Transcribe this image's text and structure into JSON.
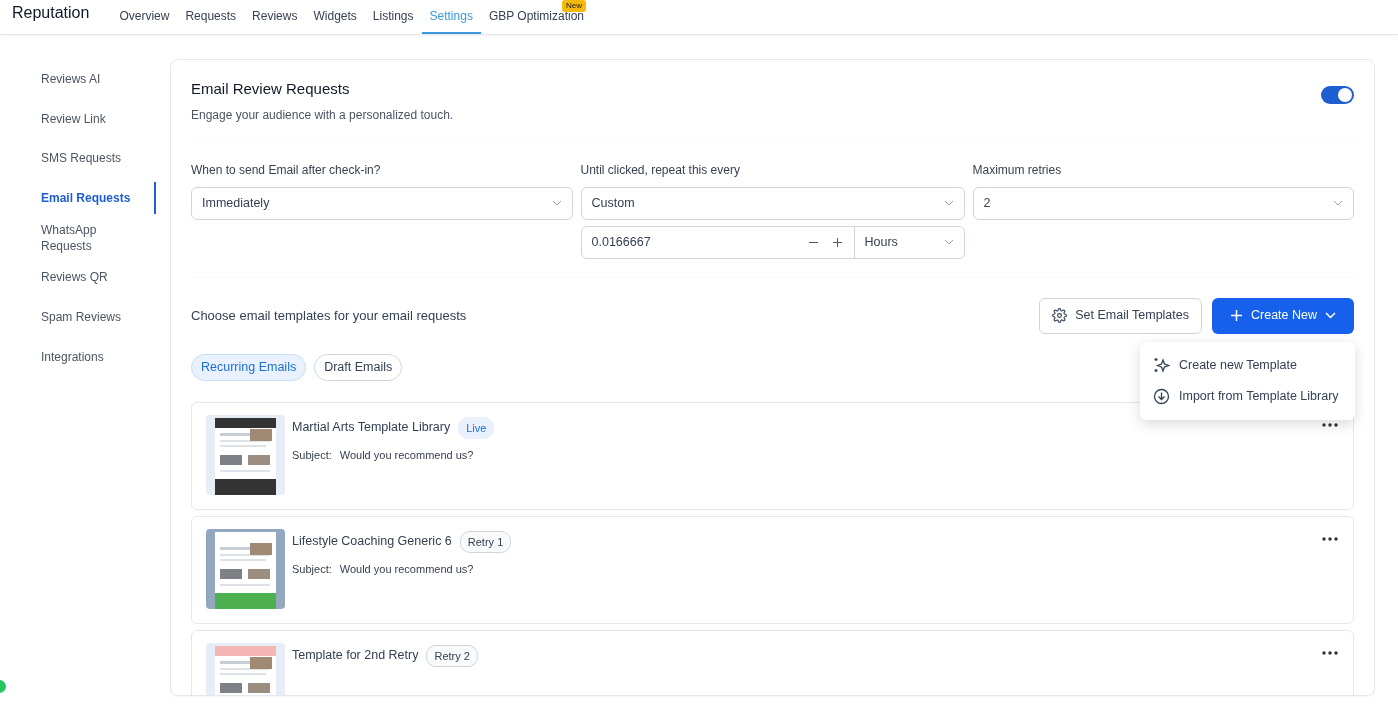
{
  "topnav": {
    "brand": "Reputation",
    "tabs": [
      {
        "label": "Overview",
        "selected": false
      },
      {
        "label": "Requests",
        "selected": false
      },
      {
        "label": "Reviews",
        "selected": false
      },
      {
        "label": "Widgets",
        "selected": false
      },
      {
        "label": "Listings",
        "selected": false
      },
      {
        "label": "Settings",
        "selected": true
      },
      {
        "label": "GBP Optimization",
        "selected": false,
        "badge": "New"
      }
    ]
  },
  "sidebar": {
    "items": [
      {
        "label": "Reviews AI",
        "selected": false
      },
      {
        "label": "Review Link",
        "selected": false
      },
      {
        "label": "SMS Requests",
        "selected": false
      },
      {
        "label": "Email Requests",
        "selected": true
      },
      {
        "label": "WhatsApp Requests",
        "selected": false
      },
      {
        "label": "Reviews QR",
        "selected": false
      },
      {
        "label": "Spam Reviews",
        "selected": false
      },
      {
        "label": "Integrations",
        "selected": false
      }
    ]
  },
  "header": {
    "title": "Email Review Requests",
    "subtitle": "Engage your audience with a personalized touch.",
    "enabled": true
  },
  "settings": {
    "send_after": {
      "label": "When to send Email after check-in?",
      "value": "Immediately"
    },
    "repeat": {
      "label": "Until clicked, repeat this every",
      "value": "Custom",
      "amount": "0.0166667",
      "unit": "Hours"
    },
    "max_retries": {
      "label": "Maximum retries",
      "value": "2"
    }
  },
  "templates": {
    "heading": "Choose email templates for your email requests",
    "set_button": "Set Email Templates",
    "create_button": "Create New",
    "menu": [
      {
        "label": "Create new Template",
        "kind": "create"
      },
      {
        "label": "Import from Template Library",
        "kind": "import"
      }
    ],
    "filters": [
      {
        "label": "Recurring Emails",
        "selected": true
      },
      {
        "label": "Draft Emails",
        "selected": false
      }
    ],
    "items": [
      {
        "name": "Martial Arts Template Library",
        "badge": "Live",
        "live": true,
        "subject_label": "Subject:",
        "subject": "Would you recommend us?"
      },
      {
        "name": "Lifestyle Coaching Generic 6",
        "badge": "Retry 1",
        "live": false,
        "subject_label": "Subject:",
        "subject": "Would you recommend us?"
      },
      {
        "name": "Template for 2nd Retry",
        "badge": "Retry 2",
        "live": false
      }
    ]
  }
}
